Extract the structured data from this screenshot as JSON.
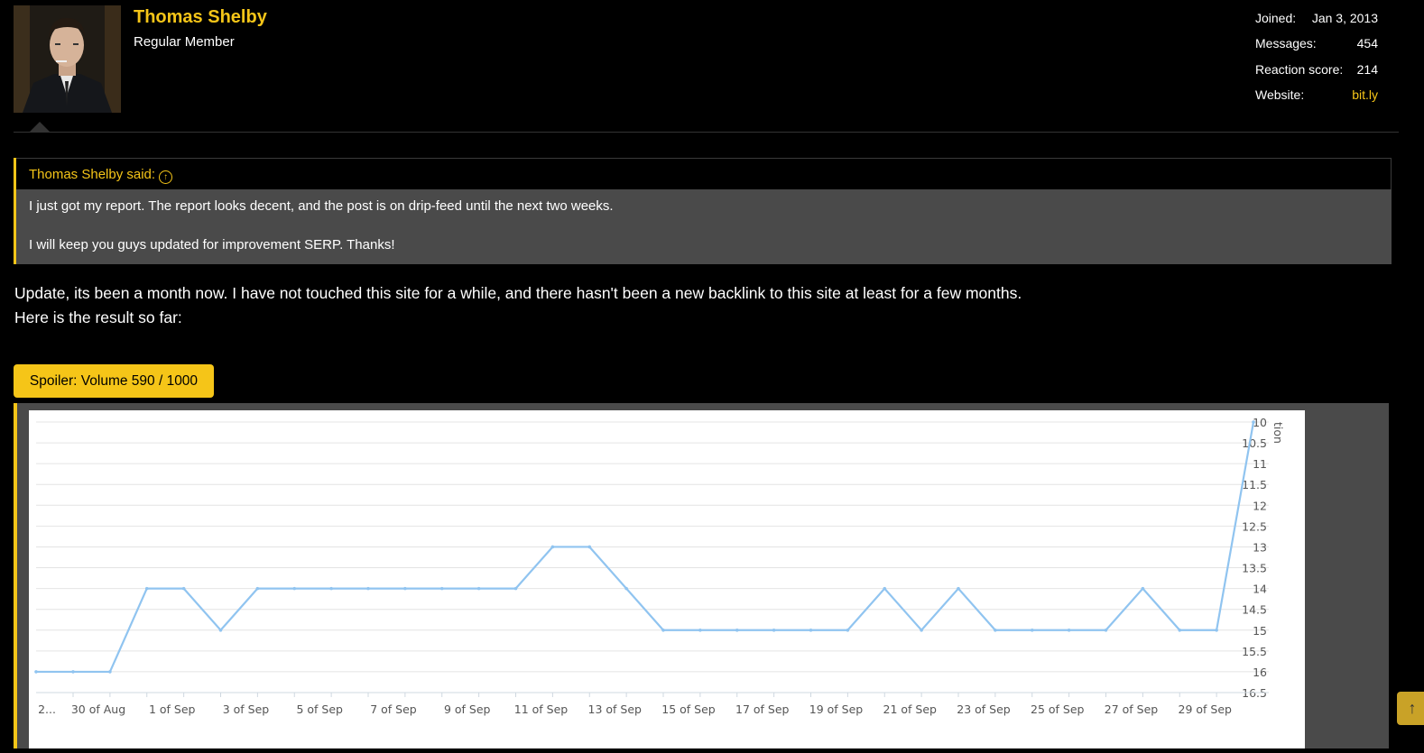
{
  "user": {
    "name": "Thomas Shelby",
    "title": "Regular Member",
    "stats": [
      {
        "label": "Joined:",
        "value": "Jan 3, 2013"
      },
      {
        "label": "Messages:",
        "value": "454"
      },
      {
        "label": "Reaction score:",
        "value": "214"
      },
      {
        "label": "Website:",
        "value": "bit.ly"
      }
    ]
  },
  "quote": {
    "author_line": "Thomas Shelby said:",
    "paragraphs": [
      "I just got my report. The report looks decent, and the post is on drip-feed until the next two weeks.",
      "I will keep you guys updated for improvement SERP. Thanks!"
    ]
  },
  "post": {
    "lines": [
      "Update, its been a month now. I have not touched this site for a while, and there hasn't been a new backlink to this site at least for a few months.",
      "Here is the result so far:"
    ]
  },
  "spoiler": {
    "label": "Spoiler: Volume 590 / 1000"
  },
  "colors": {
    "accent": "#f5c518",
    "line": "#90c4f0",
    "background": "#000000",
    "panel": "#4a4a4a"
  },
  "icons": {
    "quote_jump": "arrow-up-circle-icon",
    "scroll_top": "arrow-up-icon"
  },
  "chart_data": {
    "type": "line",
    "ylabel": "tion",
    "y_reversed": true,
    "ylim": [
      10,
      16.5
    ],
    "yticks": [
      "10",
      "10.5",
      "11",
      "11.5",
      "12",
      "12.5",
      "13",
      "13.5",
      "14",
      "14.5",
      "15",
      "15.5",
      "16",
      "16.5"
    ],
    "categories": [
      "2...",
      "30 of Aug",
      "1 of Sep",
      "3 of Sep",
      "5 of Sep",
      "7 of Sep",
      "9 of Sep",
      "11 of Sep",
      "13 of Sep",
      "15 of Sep",
      "17 of Sep",
      "19 of Sep",
      "21 of Sep",
      "23 of Sep",
      "25 of Sep",
      "27 of Sep",
      "29 of Sep"
    ],
    "series": [
      {
        "values": [
          16,
          16,
          16,
          14,
          14,
          15,
          14,
          14,
          14,
          14,
          14,
          14,
          14,
          14,
          13,
          13,
          14,
          15,
          15,
          15,
          15,
          15,
          15,
          14,
          15,
          14,
          15,
          15,
          15,
          15,
          14,
          15,
          15,
          10
        ]
      }
    ]
  }
}
